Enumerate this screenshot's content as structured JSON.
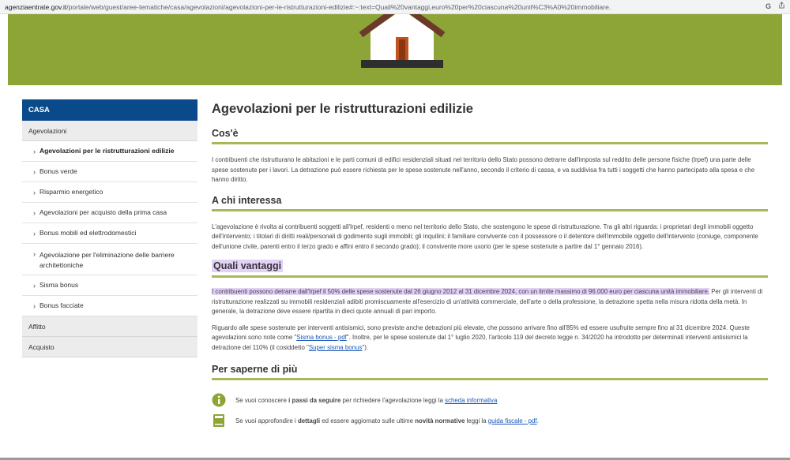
{
  "browser": {
    "url_domain": "agenziaentrate.gov.it",
    "url_path": "/portale/web/guest/aree-tematiche/casa/agevolazioni/agevolazioni-per-le-ristrutturazioni-edilizie#:~:text=Quali%20vantaggi,euro%20per%20ciascuna%20unit%C3%A0%20immobiliare.",
    "icons": [
      "google-icon",
      "share-icon"
    ]
  },
  "sidebar": {
    "header": "CASA",
    "section": "Agevolazioni",
    "items": [
      {
        "label": "Agevolazioni per le ristrutturazioni edilizie",
        "active": true
      },
      {
        "label": "Bonus verde"
      },
      {
        "label": "Risparmio energetico"
      },
      {
        "label": "Agevolazioni per acquisto della prima casa"
      },
      {
        "label": "Bonus mobili ed elettrodomestici"
      },
      {
        "label": "Agevolazione per l'eliminazione delle barriere architettoniche"
      },
      {
        "label": "Sisma bonus"
      },
      {
        "label": "Bonus facciate"
      }
    ],
    "other": [
      "Affitto",
      "Acquisto"
    ]
  },
  "main": {
    "title": "Agevolazioni per le ristrutturazioni edilizie",
    "s1": {
      "title": "Cos'è",
      "text": "I contribuenti che ristrutturano le abitazioni e le parti comuni di edifici residenziali situati nel territorio dello Stato possono detrarre dall'imposta sul reddito delle persone fisiche (Irpef) una parte delle spese sostenute per i lavori. La detrazione può essere richiesta per le spese sostenute nell'anno, secondo il criterio di cassa, e va suddivisa fra tutti i soggetti che hanno partecipato alla spesa e che hanno diritto."
    },
    "s2": {
      "title": "A chi interessa",
      "text": "L'agevolazione è rivolta ai contribuenti soggetti all'Irpef, residenti o meno nel territorio dello Stato, che sostengono le spese di ristrutturazione. Tra gli altri riguarda: i proprietari degli immobili oggetto dell'intervento; i titolari di diritti reali/personali di godimento sugli immobili; gli inquilini; il familiare convivente con il possessore o il detentore dell'immobile oggetto dell'intervento (coniuge, componente dell'unione civile, parenti entro il terzo grado e affini entro il secondo grado); il convivente more uxorio (per le spese sostenute a partire dal 1° gennaio 2016)."
    },
    "s3": {
      "title": "Quali vantaggi",
      "p1_highlight": "I contribuenti possono detrarre dall'Irpef il 50% delle spese sostenute dal 26 giugno 2012 al 31 dicembre 2024, con un limite massimo di 96.000 euro per ciascuna unità immobiliare.",
      "p1_rest": " Per gli interventi di ristrutturazione realizzati su immobili residenziali adibiti promiscuamente all'esercizio di un'attività commerciale, dell'arte o della professione, la detrazione spetta nella misura ridotta della metà. In generale, la detrazione deve essere ripartita in dieci quote annuali di pari importo.",
      "p2_a": "Riguardo alle spese sostenute per interventi antisismici, sono previste anche detrazioni più elevate, che possono arrivare fino all'85% ed essere usufruite sempre fino al 31 dicembre 2024. Queste agevolazioni sono note come \"",
      "p2_link1": "Sisma bonus - pdf",
      "p2_b": "\". Inoltre, per le spese sostenute dal 1° luglio 2020, l'articolo 119 del decreto legge n. 34/2020 ha introdotto per determinati interventi antisismici la detrazione del 110% (il cosiddetto \"",
      "p2_link2": "Super sisma bonus",
      "p2_c": "\")."
    },
    "s4": {
      "title": "Per saperne di più",
      "row1": {
        "a": "Se vuoi conoscere ",
        "bold": "i passi da seguire",
        "b": " per richiedere l'agevolazione leggi la ",
        "link": "scheda informativa"
      },
      "row2": {
        "a": "Se vuoi approfondire i ",
        "bold1": "dettagli",
        "b": " ed essere aggiornato sulle ultime ",
        "bold2": "novità normative",
        "c": " leggi la ",
        "link": "guida fiscale - pdf",
        "d": "."
      }
    },
    "colors": {
      "accent_green": "#8da436",
      "rule_green": "#a7b85a",
      "sidebar_blue": "#0b4a8a",
      "highlight": "#e2d2f7",
      "link": "#1a57b8"
    }
  }
}
